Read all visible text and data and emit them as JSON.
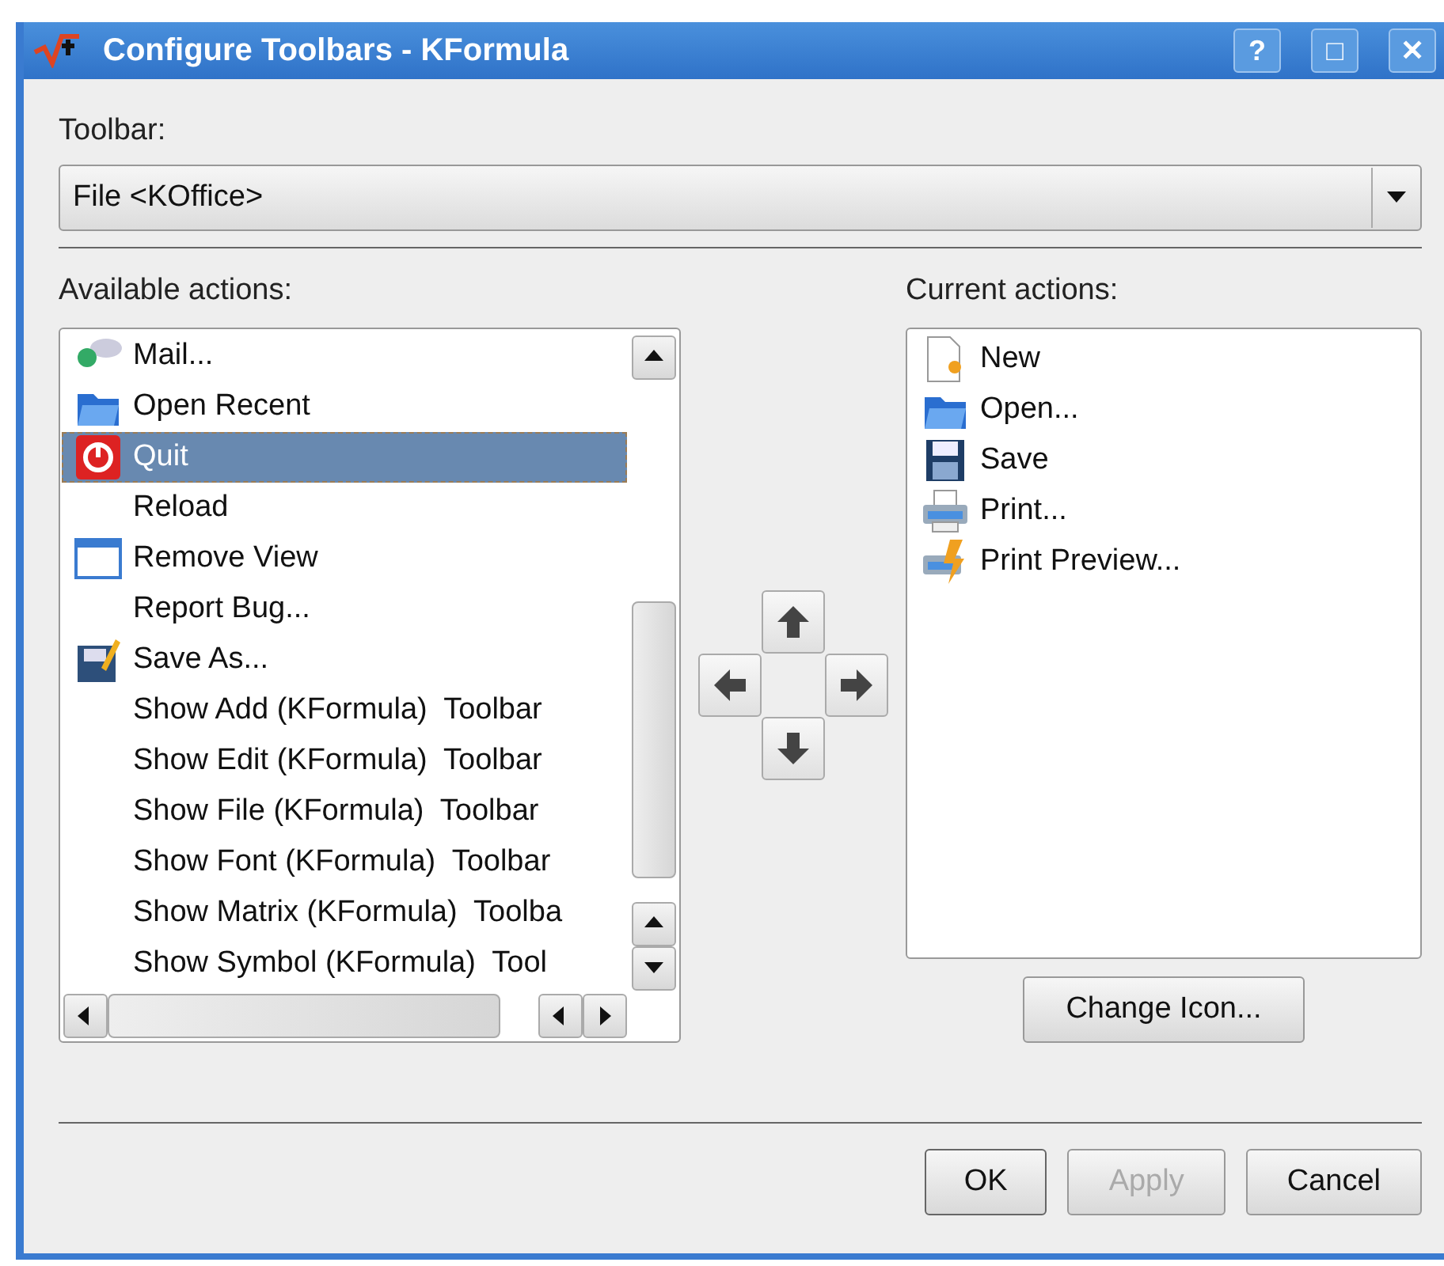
{
  "window": {
    "title": "Configure Toolbars - KFormula",
    "controls": [
      "?",
      "□",
      "✕"
    ]
  },
  "toolbar": {
    "label": "Toolbar:",
    "value": "File <KOffice>"
  },
  "available": {
    "label": "Available actions:",
    "items": [
      {
        "label": "Mail...",
        "kind": "mail",
        "selected": false
      },
      {
        "label": "Open Recent",
        "kind": "folder",
        "selected": false
      },
      {
        "label": "Quit",
        "kind": "quit",
        "selected": true
      },
      {
        "label": "Reload",
        "kind": "plain",
        "selected": false
      },
      {
        "label": "Remove View",
        "kind": "window",
        "selected": false
      },
      {
        "label": "Report Bug...",
        "kind": "plain",
        "selected": false
      },
      {
        "label": "Save As...",
        "kind": "saveas",
        "selected": false
      },
      {
        "label": "Show Add (KFormula)  Toolbar",
        "kind": "plain",
        "selected": false
      },
      {
        "label": "Show Edit (KFormula)  Toolbar",
        "kind": "plain",
        "selected": false
      },
      {
        "label": "Show File (KFormula)  Toolbar",
        "kind": "plain",
        "selected": false
      },
      {
        "label": "Show Font (KFormula)  Toolbar",
        "kind": "plain",
        "selected": false
      },
      {
        "label": "Show Matrix (KFormula)  Toolba",
        "kind": "plain",
        "selected": false
      },
      {
        "label": "Show Symbol (KFormula)  Tool",
        "kind": "plain",
        "selected": false
      }
    ]
  },
  "current": {
    "label": "Current actions:",
    "items": [
      {
        "label": "New",
        "kind": "new",
        "selected": false
      },
      {
        "label": "Open...",
        "kind": "folder",
        "selected": false
      },
      {
        "label": "Save",
        "kind": "save",
        "selected": false
      },
      {
        "label": "Print...",
        "kind": "print",
        "selected": false
      },
      {
        "label": "Print Preview...",
        "kind": "preview",
        "selected": false
      }
    ],
    "change_icon": "Change Icon..."
  },
  "buttons": [
    {
      "label": "OK",
      "default": true,
      "disabled": false
    },
    {
      "label": "Apply",
      "default": false,
      "disabled": true
    },
    {
      "label": "Cancel",
      "default": false,
      "disabled": false
    }
  ]
}
